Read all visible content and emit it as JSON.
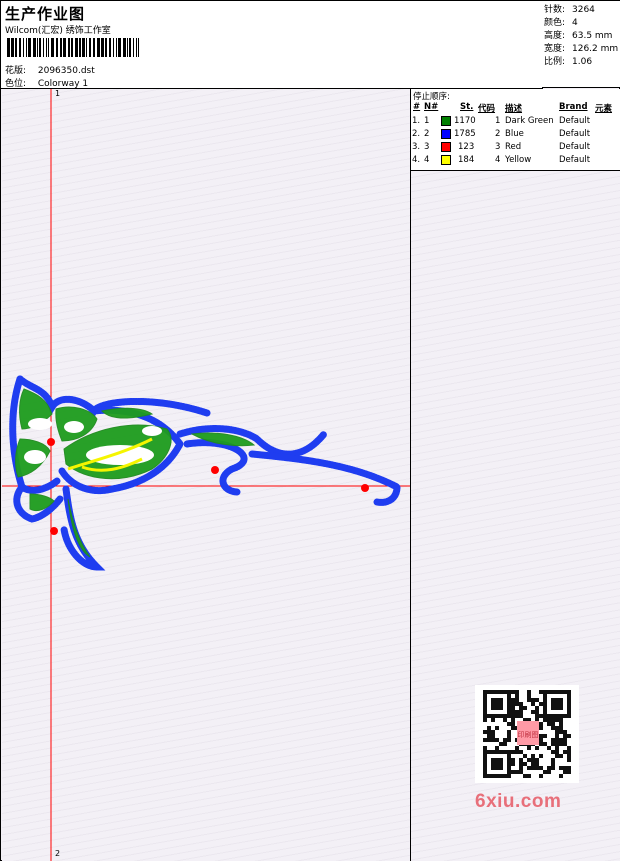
{
  "header": {
    "title": "生产作业图",
    "subtitle": "Wilcom(汇宏) 绣饰工作室",
    "design_label": "花版:",
    "design_value": "2096350.dst",
    "color_label": "色位:",
    "color_value": "Colorway 1"
  },
  "stats": {
    "stitches_label": "针数:",
    "stitches_value": "3264",
    "colors_label": "颜色:",
    "colors_value": "4",
    "height_label": "高度:",
    "height_value": "63.5 mm",
    "width_label": "宽度:",
    "width_value": "126.2 mm",
    "scale_label": "比例:",
    "scale_value": "1.06"
  },
  "stop_sequence": {
    "title": "停止顺序:",
    "headers": [
      "#",
      "N#",
      "St.",
      "代码",
      "描述",
      "Brand",
      "元素"
    ],
    "rows": [
      {
        "idx": "1.",
        "n": "1",
        "st": "1170",
        "code": "1",
        "desc": "Dark Green",
        "brand": "Default",
        "color": "#008000"
      },
      {
        "idx": "2.",
        "n": "2",
        "st": "1785",
        "code": "2",
        "desc": "Blue",
        "brand": "Default",
        "color": "#0000ff"
      },
      {
        "idx": "3.",
        "n": "3",
        "st": "123",
        "code": "3",
        "desc": "Red",
        "brand": "Default",
        "color": "#ff0000"
      },
      {
        "idx": "4.",
        "n": "4",
        "st": "184",
        "code": "4",
        "desc": "Yellow",
        "brand": "Default",
        "color": "#ffff00"
      }
    ]
  },
  "axis": {
    "top_label": "1",
    "bottom_label": "2"
  },
  "watermark": {
    "brand_text": "6xiu.com",
    "seal_text": "印刷图"
  },
  "colors": {
    "guide_line": "#ff0000",
    "brand": "#e86f7a"
  }
}
